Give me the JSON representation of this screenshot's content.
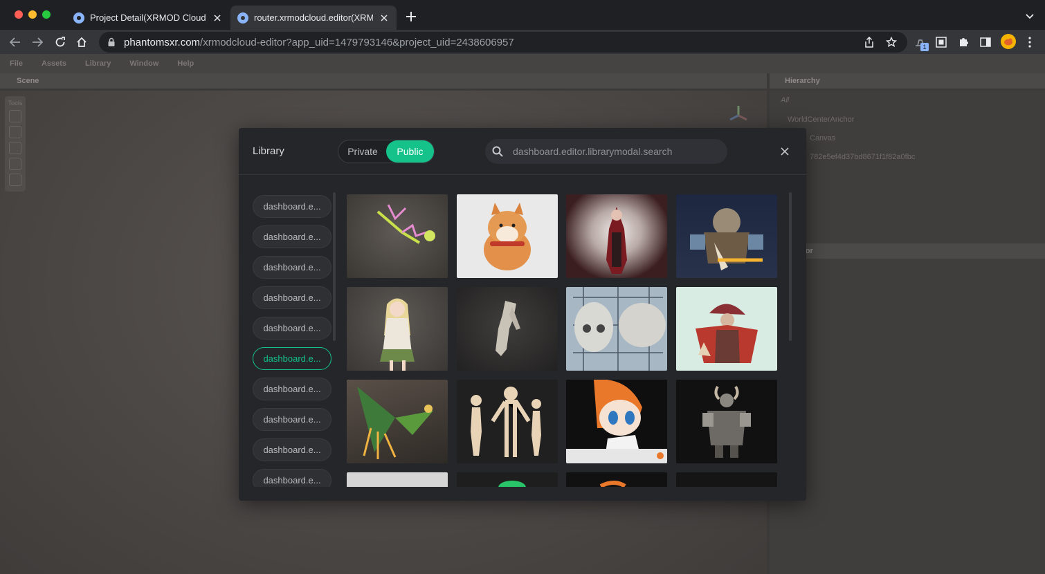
{
  "browser": {
    "tabs": [
      {
        "title": "Project Detail(XRMOD Cloud) -",
        "active": false
      },
      {
        "title": "router.xrmodcloud.editor(XRM",
        "active": true
      }
    ],
    "url_host": "phantomsxr.com",
    "url_path": "/xrmodcloud-editor?app_uid=1479793146&project_uid=2438606957",
    "extension_badge": "1"
  },
  "editor": {
    "menu": [
      "File",
      "Assets",
      "Library",
      "Window",
      "Help"
    ],
    "scene_label": "Scene",
    "tools_label": "Tools",
    "hierarchy_label": "Hierarchy",
    "hierarchy_filter": "All",
    "hierarchy_items": [
      "WorldCenterAnchor",
      "Canvas",
      "782e5ef4d37bd8671f1f82a0fbc"
    ],
    "inspector_label": "ctor"
  },
  "library": {
    "title": "Library",
    "tab_private": "Private",
    "tab_public": "Public",
    "active_tab": "Public",
    "search_placeholder": "dashboard.editor.librarymodal.search",
    "categories": [
      "dashboard.e...",
      "dashboard.e...",
      "dashboard.e...",
      "dashboard.e...",
      "dashboard.e...",
      "dashboard.e...",
      "dashboard.e...",
      "dashboard.e...",
      "dashboard.e...",
      "dashboard.e..."
    ],
    "active_category_index": 5,
    "assets": [
      {
        "name": "fantasy-weapon-thumbnail"
      },
      {
        "name": "shiba-dog-thumbnail"
      },
      {
        "name": "red-hood-warrior-thumbnail"
      },
      {
        "name": "dwarf-blacksmith-thumbnail"
      },
      {
        "name": "anime-girl-thumbnail"
      },
      {
        "name": "hand-sculpt-thumbnail"
      },
      {
        "name": "skull-study-thumbnail"
      },
      {
        "name": "red-cloak-wizard-thumbnail"
      },
      {
        "name": "phoenix-bird-thumbnail"
      },
      {
        "name": "base-body-thumbnail"
      },
      {
        "name": "anime-fox-girl-thumbnail"
      },
      {
        "name": "armored-knight-thumbnail"
      },
      {
        "name": "partial-thumbnail-1"
      },
      {
        "name": "partial-thumbnail-2"
      },
      {
        "name": "partial-thumbnail-3"
      },
      {
        "name": "partial-thumbnail-4"
      }
    ]
  }
}
